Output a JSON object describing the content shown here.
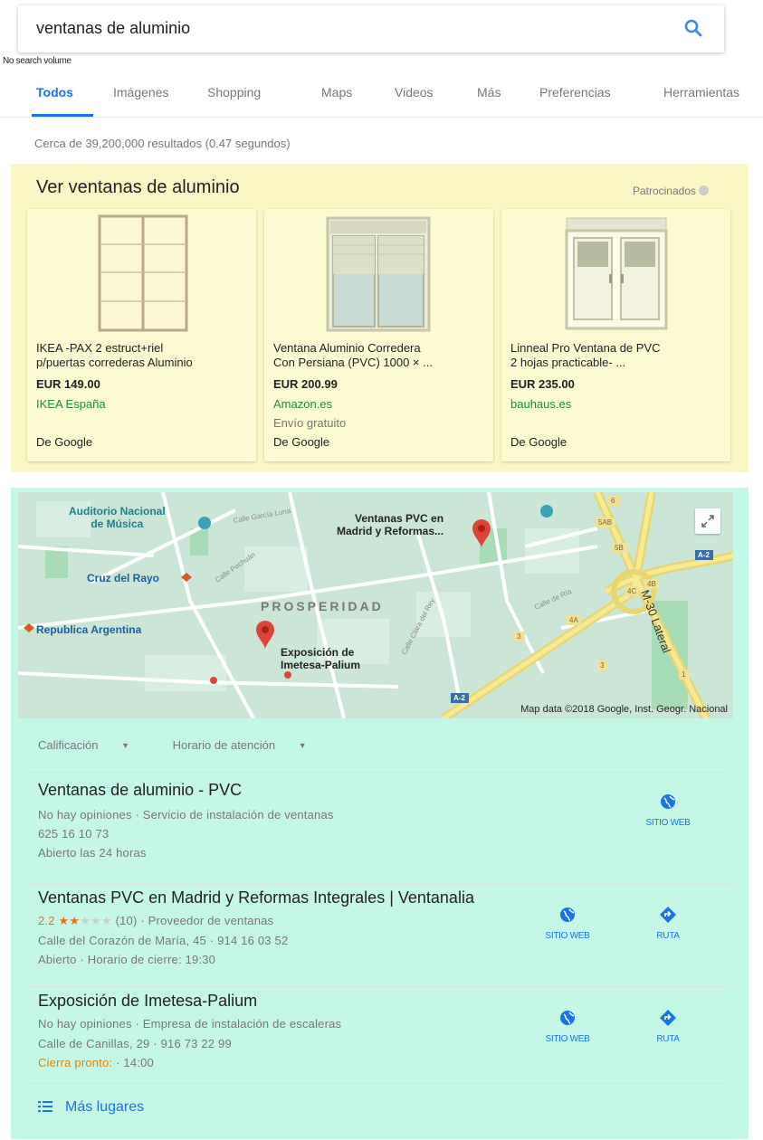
{
  "search": {
    "query": "ventanas de aluminio",
    "note": "No search volume"
  },
  "tabs": [
    "Todos",
    "Imágenes",
    "Shopping",
    "Maps",
    "Videos",
    "Más",
    "Preferencias",
    "Herramientas"
  ],
  "results_count": "Cerca de 39,200,000 resultados (0.47 segundos)",
  "shopping": {
    "title": "Ver ventanas de aluminio",
    "sponsored": "Patrocinados",
    "products": [
      {
        "title_line1": "IKEA -PAX 2 estruct+riel",
        "title_line2": "p/puertas correderas Aluminio",
        "price": "EUR 149.00",
        "store": "IKEA España",
        "shipping": "",
        "source": "De Google"
      },
      {
        "title_line1": "Ventana Aluminio Corredera",
        "title_line2": "Con Persiana (PVC) 1000 × ...",
        "price": "EUR 200.99",
        "store": "Amazon.es",
        "shipping": "Envío gratuito",
        "source": "De Google"
      },
      {
        "title_line1": "Linneal Pro Ventana de PVC",
        "title_line2": "2 hojas practicable- ...",
        "price": "EUR 235.00",
        "store": "bauhaus.es",
        "shipping": "",
        "source": "De Google"
      }
    ]
  },
  "map": {
    "labels": {
      "auditorio_1": "Auditorio Nacional",
      "auditorio_2": "de Música",
      "ventanas_1": "Ventanas PVC en",
      "ventanas_2": "Madrid y Reformas...",
      "cruz": "Cruz del Rayo",
      "republica": "Republica Argentina",
      "prosperidad": "PROSPERIDAD",
      "exposicion_1": "Exposición de",
      "exposicion_2": "Imetesa-Palium",
      "calle_garcia": "Calle García Luna",
      "calle_pechuan": "Calle Pechuán",
      "calle_clara": "Calle Clara del Rey",
      "calle_ria": "Calle de Ría",
      "m30": "M-30 Lateral",
      "a2_1": "A-2",
      "a2_2": "A-2",
      "exit_6": "6",
      "exit_5ab": "5AB",
      "exit_5b": "5B",
      "exit_4b": "4B",
      "exit_4c": "4C",
      "exit_4a": "4A",
      "exit_3a": "3",
      "exit_3b": "3",
      "exit_1": "1"
    },
    "footer": "Map data ©2018 Google, Inst. Geogr. Nacional"
  },
  "filters": [
    "Calificación",
    "Horario de atención"
  ],
  "listings": [
    {
      "name": "Ventanas de aluminio - PVC",
      "line1": "No hay opiniones · Servicio de instalación de ventanas",
      "line2": "625 16 10 73",
      "line3": "Abierto las 24 horas",
      "website": "SITIO WEB"
    },
    {
      "name": "Ventanas PVC en Madrid y Reformas Integrales | Ventanalia",
      "rating": "2.2",
      "stars_on": "★★",
      "stars_off": "★★★",
      "reviews": "(10) · Proveedor de ventanas",
      "line2": "Calle del Corazón de María, 45 · 914 16 03 52",
      "line3": "Abierto · Horario de cierre: 19:30",
      "website": "SITIO WEB",
      "route": "RUTA"
    },
    {
      "name": "Exposición de Imetesa-Palium",
      "line1": "No hay opiniones · Empresa de instalación de escaleras",
      "line2": "Calle de Canillas, 29 · 916 73 22 99",
      "closing": "Cierra pronto:",
      "line3_rest": " · 14:00",
      "website": "SITIO WEB",
      "route": "RUTA"
    }
  ],
  "more_places": "Más lugares"
}
